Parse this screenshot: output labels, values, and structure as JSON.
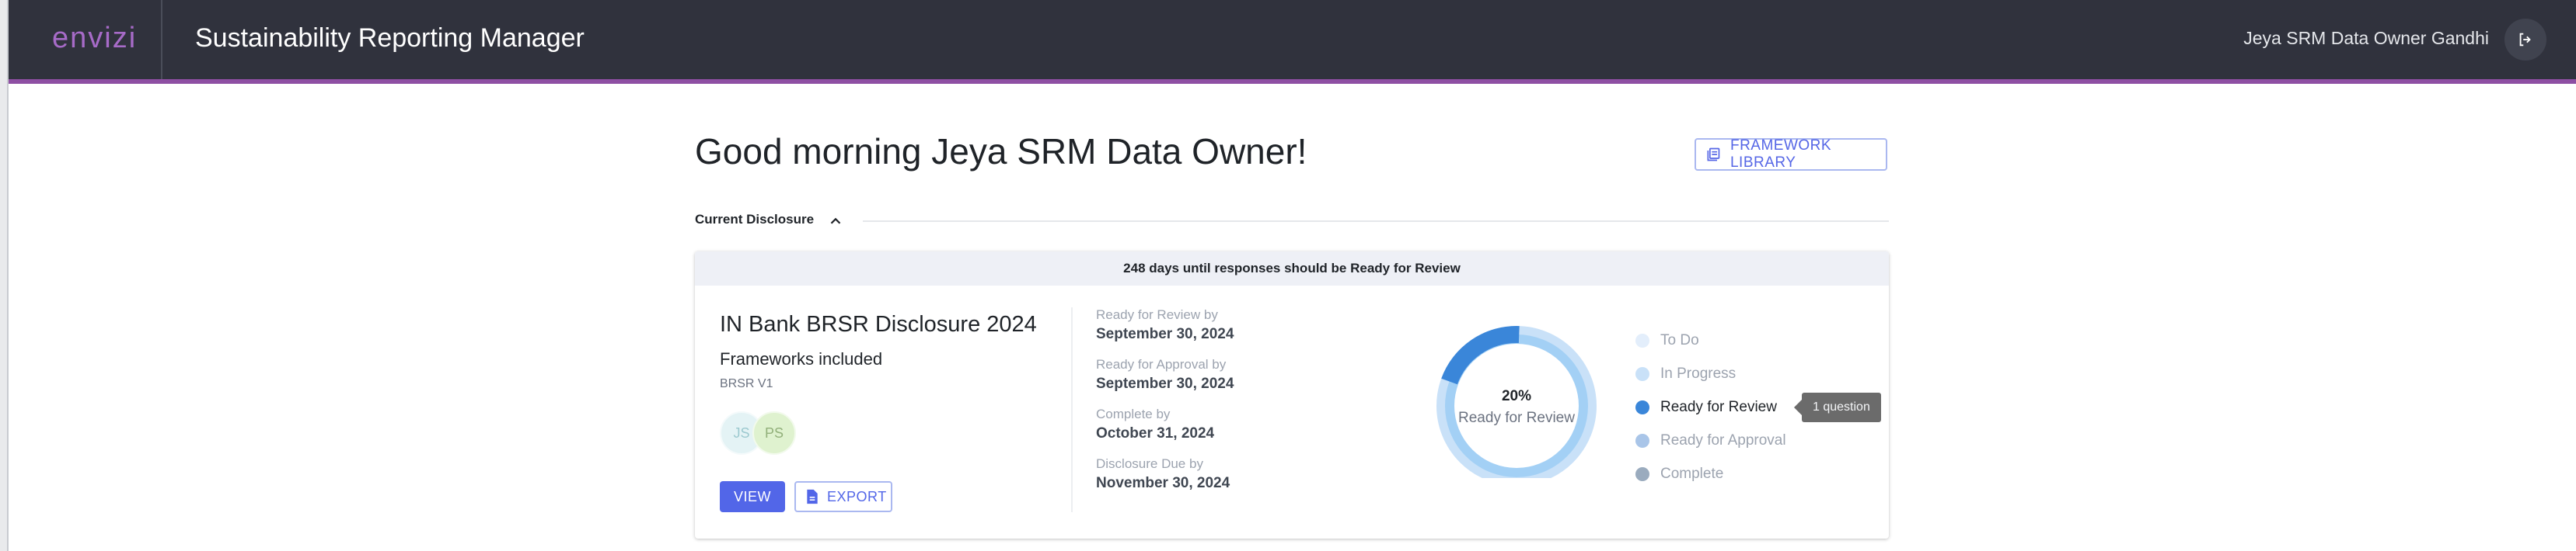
{
  "header": {
    "logo": "envizi",
    "app_title": "Sustainability Reporting Manager",
    "user_name": "Jeya SRM Data Owner Gandhi",
    "accent_color": "#8e4fa3",
    "logout_icon": "logout-icon"
  },
  "main": {
    "greeting": "Good morning Jeya SRM Data Owner!",
    "framework_library_label": "FRAMEWORK LIBRARY",
    "section_label": "Current Disclosure"
  },
  "disclosure": {
    "banner": "248 days until responses should be Ready for Review",
    "title": "IN Bank BRSR Disclosure 2024",
    "frameworks_label": "Frameworks included",
    "frameworks": [
      "BRSR V1"
    ],
    "avatars": [
      "JS",
      "PS"
    ],
    "view_label": "VIEW",
    "export_label": "EXPORT",
    "dates": [
      {
        "label": "Ready for Review by",
        "value": "September 30, 2024"
      },
      {
        "label": "Ready for Approval by",
        "value": "September 30, 2024"
      },
      {
        "label": "Complete by",
        "value": "October 31, 2024"
      },
      {
        "label": "Disclosure Due by",
        "value": "November 30, 2024"
      }
    ],
    "progress": {
      "percent_label": "20%",
      "status_label": "Ready for Review",
      "ready_for_review_fraction": 0.2
    },
    "legend": [
      {
        "label": "To Do",
        "color": "#e3eefb",
        "active": false
      },
      {
        "label": "In Progress",
        "color": "#c9e1f8",
        "active": false
      },
      {
        "label": "Ready for Review",
        "color": "#3a86d9",
        "active": true
      },
      {
        "label": "Ready for Approval",
        "color": "#a9c5e8",
        "active": false
      },
      {
        "label": "Complete",
        "color": "#9aabbe",
        "active": false
      }
    ],
    "tooltip": "1 question"
  }
}
